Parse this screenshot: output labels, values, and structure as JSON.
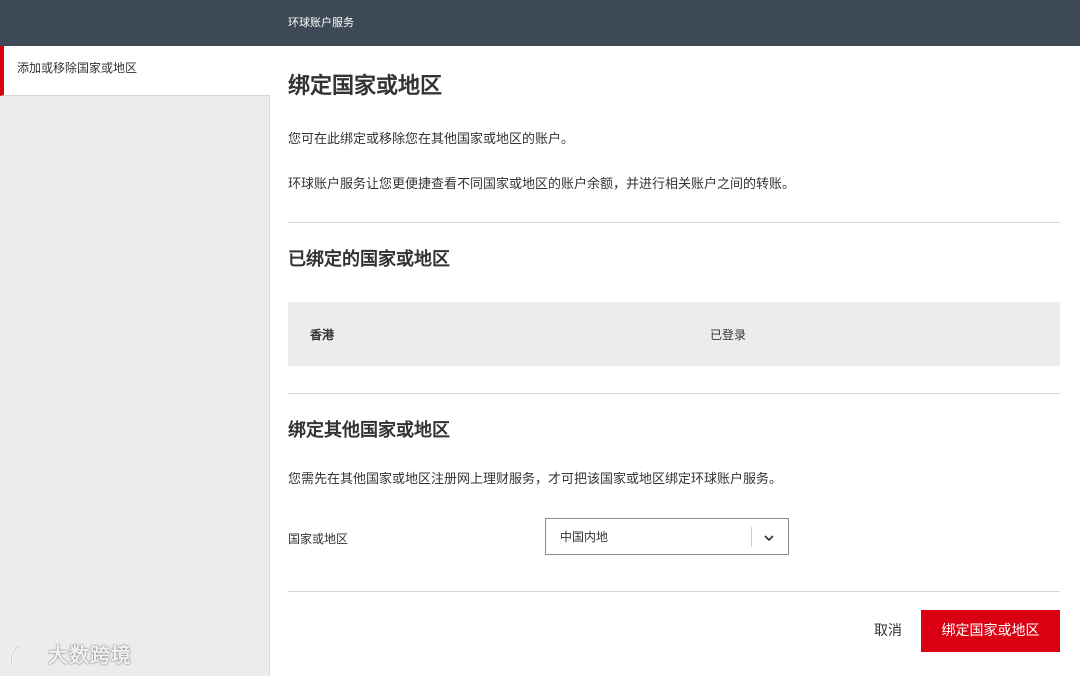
{
  "header": {
    "title": "环球账户服务"
  },
  "sidebar": {
    "items": [
      {
        "label": "添加或移除国家或地区"
      }
    ]
  },
  "main": {
    "title": "绑定国家或地区",
    "intro": [
      "您可在此绑定或移除您在其他国家或地区的账户。",
      "环球账户服务让您更便捷查看不同国家或地区的账户余额，并进行相关账户之间的转账。"
    ],
    "linked_section": {
      "title": "已绑定的国家或地区",
      "rows": [
        {
          "region": "香港",
          "status": "已登录"
        }
      ]
    },
    "link_other": {
      "title": "绑定其他国家或地区",
      "description": "您需先在其他国家或地区注册网上理财服务，才可把该国家或地区绑定环球账户服务。",
      "field_label": "国家或地区",
      "selected_value": "中国内地"
    },
    "actions": {
      "cancel_label": "取消",
      "submit_label": "绑定国家或地区"
    }
  },
  "watermark": {
    "text": "大数跨境"
  },
  "colors": {
    "header_bg": "#3d4a55",
    "accent_red": "#db0011",
    "sidebar_bg": "#ececec",
    "table_bg": "#ececec"
  },
  "icons": {
    "select_arrow": "chevron-down-icon"
  }
}
